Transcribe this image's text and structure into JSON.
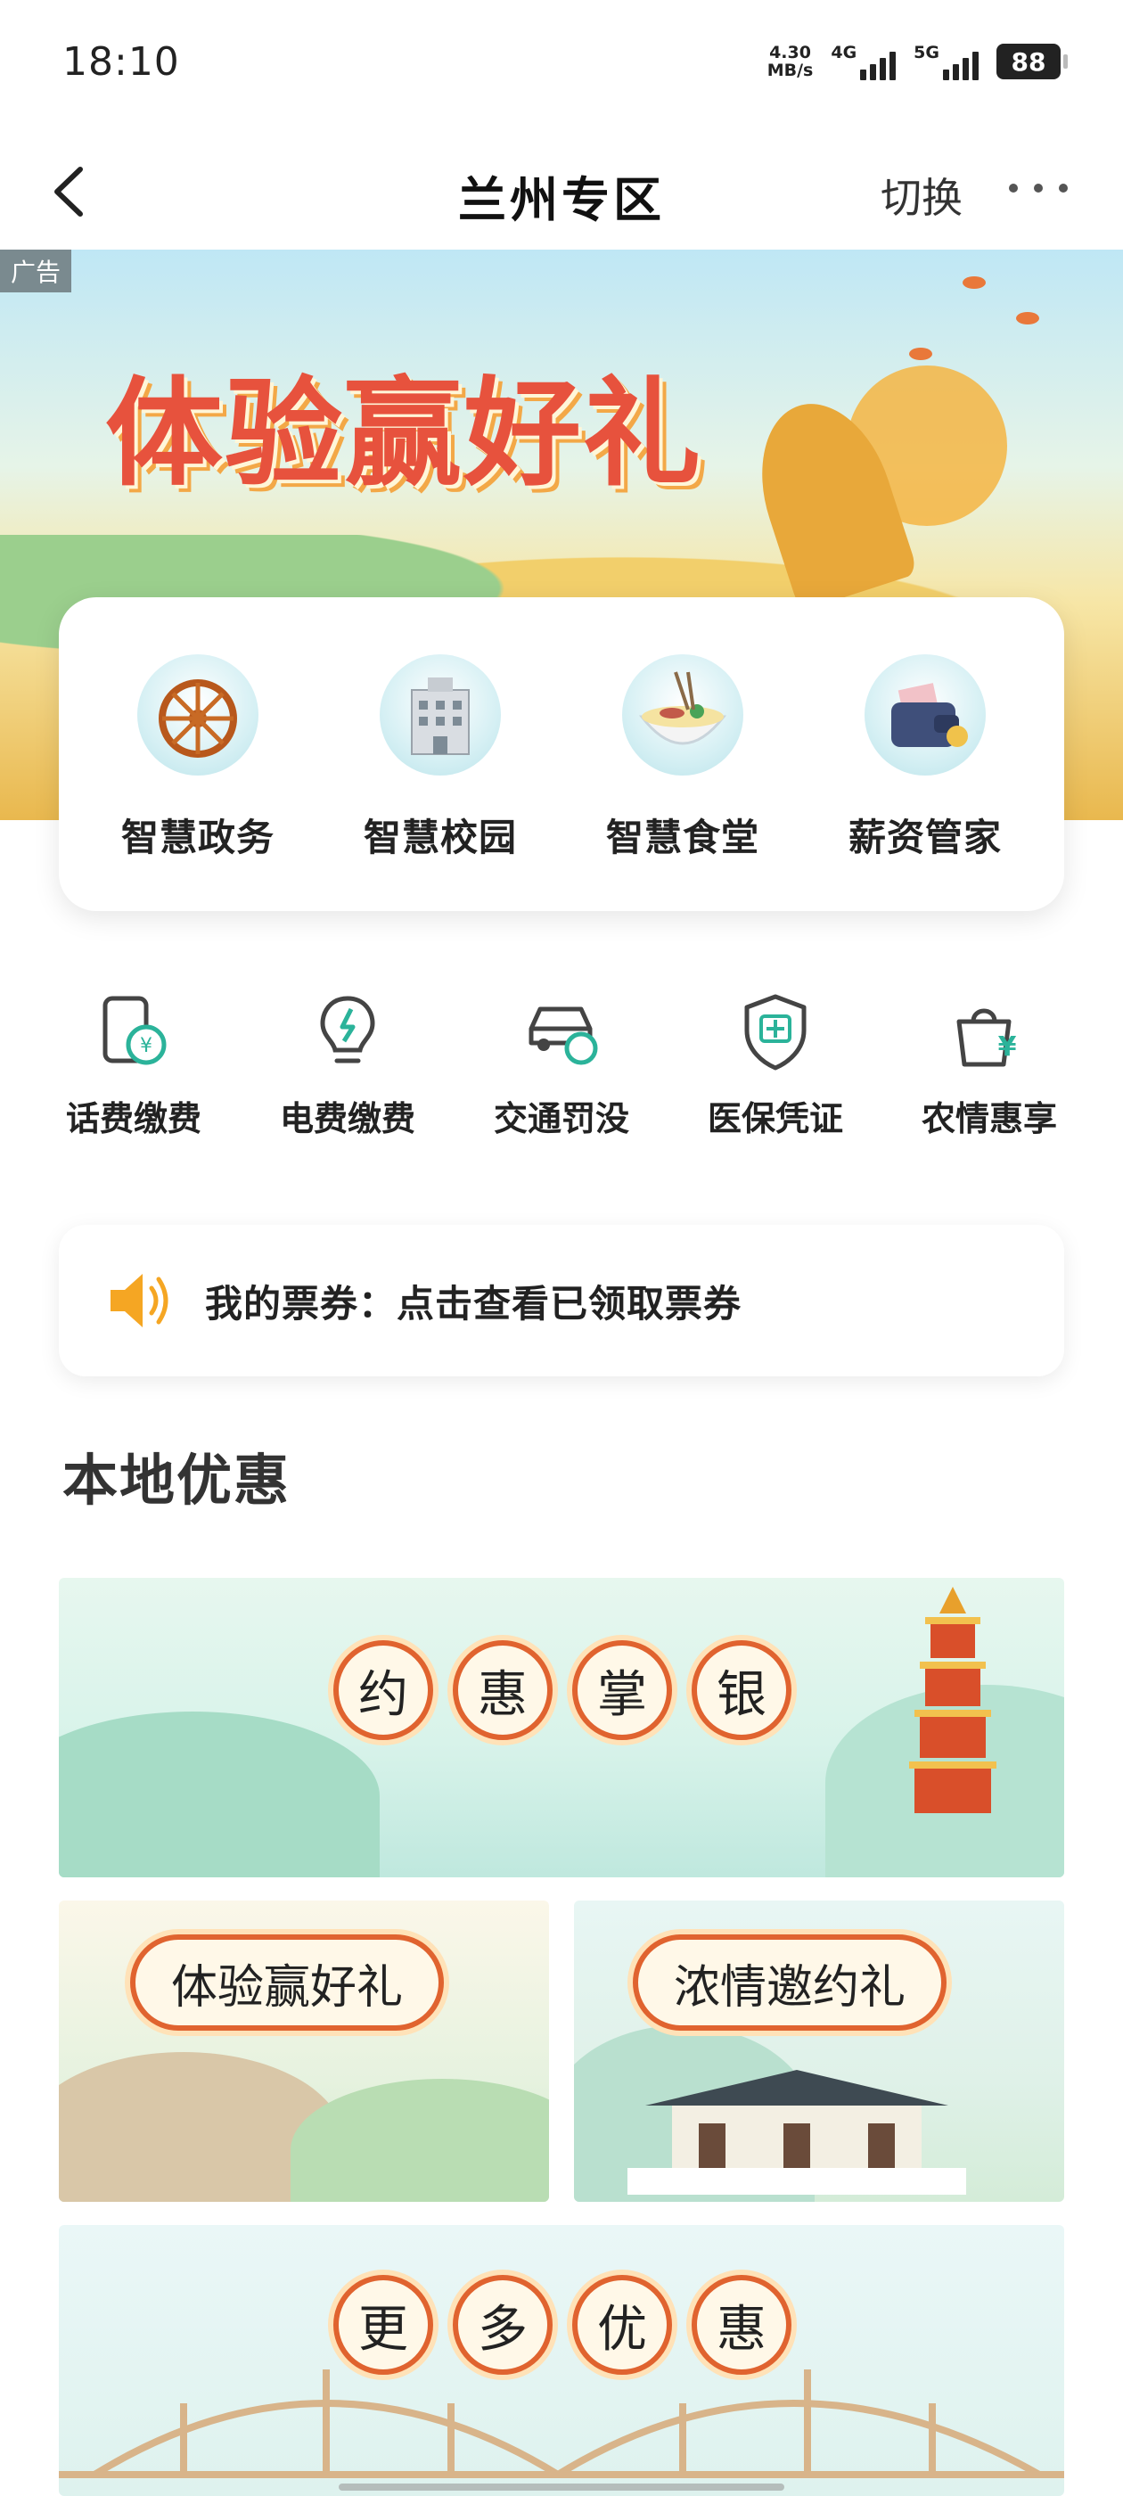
{
  "status_bar": {
    "time": "18:10",
    "speed_value": "4.30",
    "speed_unit": "MB/s",
    "network_1": "4G",
    "network_2": "5G",
    "battery": "88"
  },
  "nav": {
    "title": "兰州专区",
    "switch_label": "切换",
    "back_icon": "chevron-left-icon",
    "more_icon": "more-dots-icon"
  },
  "hero": {
    "ad_label": "广告",
    "headline": "体验赢好礼"
  },
  "features": [
    {
      "label": "智慧政务",
      "icon": "waterwheel-icon"
    },
    {
      "label": "智慧校园",
      "icon": "school-building-icon"
    },
    {
      "label": "智慧食堂",
      "icon": "noodle-bowl-icon"
    },
    {
      "label": "薪资管家",
      "icon": "wallet-icon"
    }
  ],
  "services": [
    {
      "label": "话费缴费",
      "icon": "phone-bill-icon"
    },
    {
      "label": "电费缴费",
      "icon": "lightbulb-icon"
    },
    {
      "label": "交通罚没",
      "icon": "car-fine-icon"
    },
    {
      "label": "医保凭证",
      "icon": "medical-shield-icon"
    },
    {
      "label": "农情惠享",
      "icon": "shopping-bag-icon"
    }
  ],
  "notice": {
    "text": "我的票券：点击查看已领取票券",
    "icon": "speaker-icon"
  },
  "local_deals": {
    "title": "本地优惠",
    "banner_main": [
      "约",
      "惠",
      "掌",
      "银"
    ],
    "banner_left": "体验赢好礼",
    "banner_right": "浓情邀约礼",
    "banner_more": [
      "更",
      "多",
      "优",
      "惠"
    ]
  },
  "colors": {
    "accent_orange": "#e0632f",
    "hero_red": "#e7523d",
    "service_green": "#2bb39a"
  }
}
